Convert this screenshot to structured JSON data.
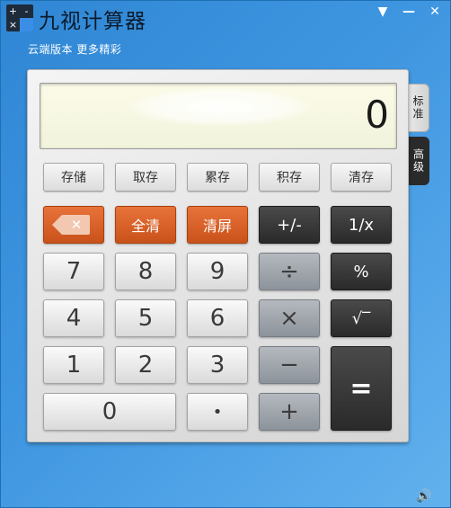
{
  "app": {
    "title": "九视计算器",
    "subtitle": "云端版本 更多精彩",
    "icon_cells": [
      "+",
      "-",
      "×",
      ""
    ]
  },
  "window": {
    "menu_icon": "▼",
    "minimize_icon": "—",
    "close_icon": "✕"
  },
  "display": {
    "value": "0"
  },
  "tabs": {
    "standard": "标准",
    "advanced": "高级"
  },
  "memory": {
    "store": "存储",
    "recall": "取存",
    "add": "累存",
    "multiply": "积存",
    "clear": "清存"
  },
  "keys": {
    "backspace": "✕",
    "all_clear": "全清",
    "clear_screen": "清屏",
    "plus_minus": "+/-",
    "reciprocal": "1/x",
    "seven": "7",
    "eight": "8",
    "nine": "9",
    "divide": "÷",
    "percent": "%",
    "four": "4",
    "five": "5",
    "six": "6",
    "multiply": "×",
    "sqrt": "√‾",
    "one": "1",
    "two": "2",
    "three": "3",
    "minus": "−",
    "equals": "=",
    "zero": "0",
    "dot": "•",
    "plus": "+"
  },
  "colors": {
    "window_bg": "#3f96e0",
    "orange_key": "#d65f24",
    "dark_key": "#2f2f2f",
    "display_bg": "#f6f7e2"
  },
  "icons": {
    "app": "calculator-app-icon",
    "volume": "speaker-icon"
  },
  "footer": {
    "volume_glyph": "🔊"
  }
}
